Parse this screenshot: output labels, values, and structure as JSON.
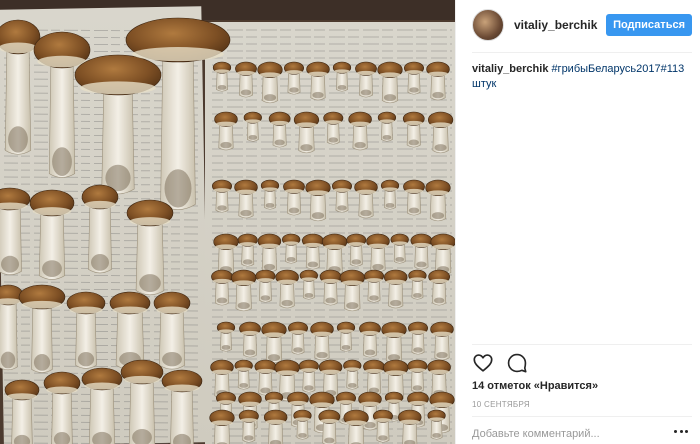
{
  "post": {
    "username": "vitaliy_berchik",
    "follow_label": "Подписаться",
    "caption_user": "vitaliy_berchik",
    "caption_tags": "#грибыБеларусь2017#113штук",
    "likes_text": "14 отметок «Нравится»",
    "date_text": "10 СЕНТЯБРЯ",
    "comment_placeholder": "Добавьте комментарий...",
    "photo_alt": "грибы",
    "icons": {
      "like": "heart-icon",
      "comment": "speech-bubble-icon",
      "more": "more-options-icon"
    }
  },
  "colors": {
    "follow_button": "#3897f0",
    "hashtag": "#003569",
    "text": "#262626",
    "muted": "#999999"
  }
}
